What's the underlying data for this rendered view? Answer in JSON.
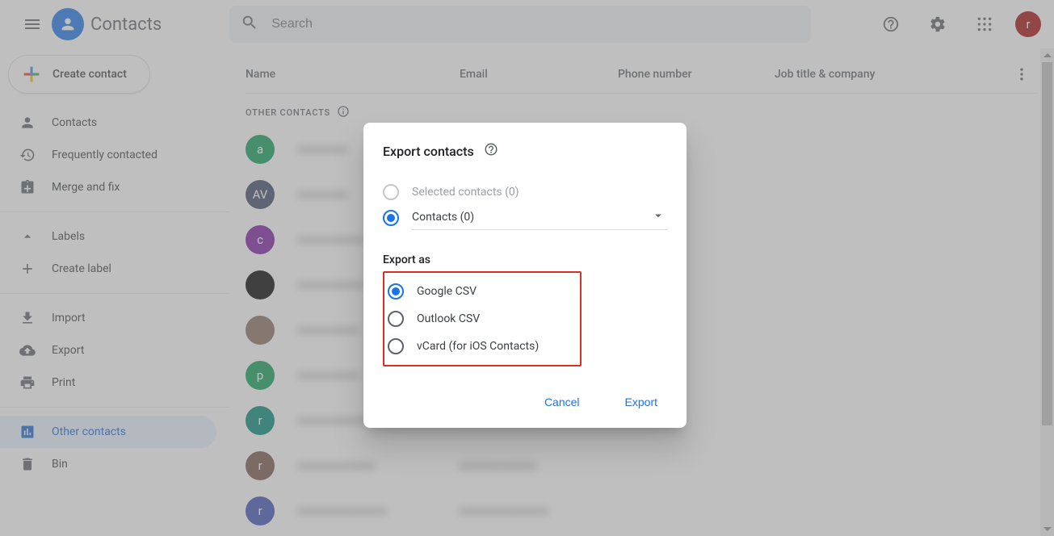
{
  "header": {
    "app_title": "Contacts",
    "search_placeholder": "Search",
    "avatar_letter": "r"
  },
  "sidebar": {
    "create_label": "Create contact",
    "items": [
      {
        "label": "Contacts"
      },
      {
        "label": "Frequently contacted"
      },
      {
        "label": "Merge and fix"
      }
    ],
    "labels_header": "Labels",
    "create_label_label": "Create label",
    "actions": [
      {
        "label": "Import"
      },
      {
        "label": "Export"
      },
      {
        "label": "Print"
      }
    ],
    "other_contacts_label": "Other contacts",
    "bin_label": "Bin"
  },
  "columns": {
    "name": "Name",
    "email": "Email",
    "phone": "Phone number",
    "job": "Job title & company"
  },
  "section_label": "OTHER CONTACTS",
  "rows": [
    {
      "letter": "a",
      "bg": "#0f9d58",
      "name": "xxxxxxxxx",
      "email": ""
    },
    {
      "letter": "AV",
      "bg": "#3f4a6b",
      "name": "xxxxxxxxx",
      "email": ""
    },
    {
      "letter": "c",
      "bg": "#7b1fa2",
      "name": "xxxxxxxxxxxx",
      "email": ""
    },
    {
      "letter": "",
      "bg": "#000000",
      "name": "xxxxxxxxxxxx",
      "email": ""
    },
    {
      "letter": "",
      "bg": "#8d6e63",
      "name": "xxxxxxxxxxx",
      "email": ""
    },
    {
      "letter": "p",
      "bg": "#0f9d58",
      "name": "xxxxxxxxxxx",
      "email": ""
    },
    {
      "letter": "r",
      "bg": "#00897b",
      "name": "xxxxxxxxxxxxxx",
      "email": "xxxxxxxxxxxxxx"
    },
    {
      "letter": "r",
      "bg": "#795548",
      "name": "xxxxxxxxxxxxxx",
      "email": "xxxxxxxxxxxxxx"
    },
    {
      "letter": "r",
      "bg": "#3f51b5",
      "name": "xxxxxxxxxxxxxxxx",
      "email": "xxxxxxxxxxxxxxxx"
    }
  ],
  "dialog": {
    "title": "Export contacts",
    "selected_option": "Selected contacts (0)",
    "contacts_option": "Contacts (0)",
    "export_as_label": "Export as",
    "formats": [
      "Google CSV",
      "Outlook CSV",
      "vCard (for iOS Contacts)"
    ],
    "cancel": "Cancel",
    "export": "Export"
  }
}
